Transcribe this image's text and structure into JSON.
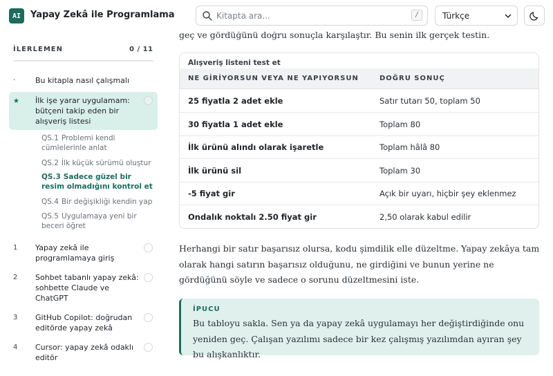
{
  "app": {
    "logo_text": "AI",
    "title": "Yapay Zekâ ile Programlama",
    "accent_color": "#1d6b5f"
  },
  "search": {
    "placeholder": "Kitapta ara...",
    "shortcut": "/"
  },
  "language": {
    "selected": "Türkçe"
  },
  "theme_toggle": {
    "icon": "moon-icon"
  },
  "sidebar": {
    "progress_label": "İLERLEMEN",
    "progress_count": "0 / 11",
    "progress_fraction": 0.0,
    "items": [
      {
        "num": "·",
        "label": "Bu kitapla nasıl çalışmalı"
      },
      {
        "num": "★",
        "label": "İlk işe yarar uygulamam: bütçeni takip eden bir alışveriş listesi"
      },
      {
        "num": "1",
        "label": "Yapay zekâ ile programlamaya giriş"
      },
      {
        "num": "2",
        "label": "Sohbet tabanlı yapay zekâ: sohbette Claude ve ChatGPT"
      },
      {
        "num": "3",
        "label": "GitHub Copilot: doğrudan editörde yapay zekâ"
      },
      {
        "num": "4",
        "label": "Cursor: yapay zekâ odaklı editör"
      }
    ],
    "subitems": [
      {
        "num": "QS.1",
        "label": "Problemi kendi cümlelerinle anlat"
      },
      {
        "num": "QS.2",
        "label": "İlk küçük sürümü oluştur"
      },
      {
        "num": "QS.3",
        "label": "Sadece güzel bir resim olmadığını kontrol et"
      },
      {
        "num": "QS.4",
        "label": "Bir değişikliği kendin yap"
      },
      {
        "num": "QS.5",
        "label": "Uygulamaya yeni bir beceri öğret"
      }
    ]
  },
  "main": {
    "intro_tail": "geç ve gördüğünü doğru sonuçla karşılaştır. Bu senin ilk gerçek testin.",
    "table": {
      "caption": "Alışveriş listeni test et",
      "headers": [
        "NE GİRİYORSUN VEYA NE YAPIYORSUN",
        "DOĞRU SONUÇ"
      ],
      "rows": [
        [
          "25 fiyatla 2 adet ekle",
          "Satır tutarı 50, toplam 50"
        ],
        [
          "30 fiyatla 1 adet ekle",
          "Toplam 80"
        ],
        [
          "İlk ürünü alındı olarak işaretle",
          "Toplam hâlâ 80"
        ],
        [
          "İlk ürünü sil",
          "Toplam 30"
        ],
        [
          "-5 fiyat gir",
          "Açık bir uyarı, hiçbir şey eklenmez"
        ],
        [
          "Ondalık noktalı 2.50 fiyat gir",
          "2,50 olarak kabul edilir"
        ]
      ]
    },
    "paragraph": "Herhangi bir satır başarısız olursa, kodu şimdilik elle düzeltme. Yapay zekâya tam olarak hangi satırın başarısız olduğunu, ne girdiğini ve bunun yerine ne gördüğünü söyle ve sadece o sorunu düzeltmesini iste.",
    "tip": {
      "label": "İPUCU",
      "text": "Bu tabloyu sakla. Sen ya da yapay zekâ uygulamayı her değiştirdiğinde onu yeniden geç. Çalışan yazılımı sadece bir kez çalışmış yazılımdan ayıran şey bu alışkanlıktır."
    }
  }
}
